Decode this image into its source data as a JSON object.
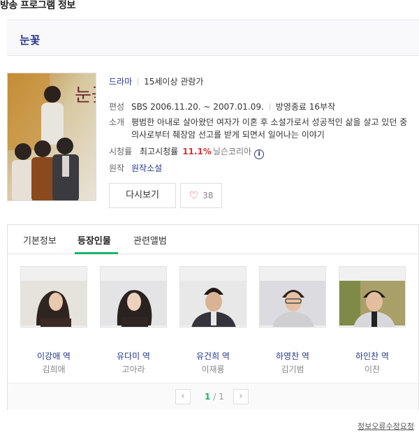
{
  "section_title": "방송 프로그램 정보",
  "program": {
    "title": "눈꽃",
    "genre": "드라마",
    "age_rating": "15세이상 관람가",
    "schedule_label": "편성",
    "schedule_value": "SBS 2006.11.20. ~ 2007.01.09.",
    "status": "방영종료 16부작",
    "synopsis_label": "소개",
    "synopsis": "평범한 아내로 살아왔던 여자가 이혼 후 소설가로서 성공적인 삶을 살고 있던 중 의사로부터 췌장암 선고를 받게 되면서 일어나는 이야기",
    "ratings_label": "시청률",
    "ratings_text": "최고시청률",
    "ratings_value": "11.1%",
    "ratings_source": "닐슨코리아",
    "original_label": "원작",
    "original_value": "원작소설"
  },
  "buttons": {
    "rewatch": "다시보기",
    "like_count": "38"
  },
  "tabs": [
    "기본정보",
    "등장인물",
    "관련앨범"
  ],
  "active_tab": 1,
  "cast": [
    {
      "role": "이강애 역",
      "actor": "김희애"
    },
    {
      "role": "유다미 역",
      "actor": "고아라"
    },
    {
      "role": "유건희 역",
      "actor": "이재룡"
    },
    {
      "role": "하영찬 역",
      "actor": "김기범"
    },
    {
      "role": "하인찬 역",
      "actor": "이찬"
    }
  ],
  "pagination": {
    "current": "1",
    "separator": "/",
    "total": "1"
  },
  "report_link": "정보오류수정요청",
  "colors": {
    "accent_green": "#19b26b",
    "title_navy": "#27378e",
    "rating_red": "#dd3333"
  }
}
